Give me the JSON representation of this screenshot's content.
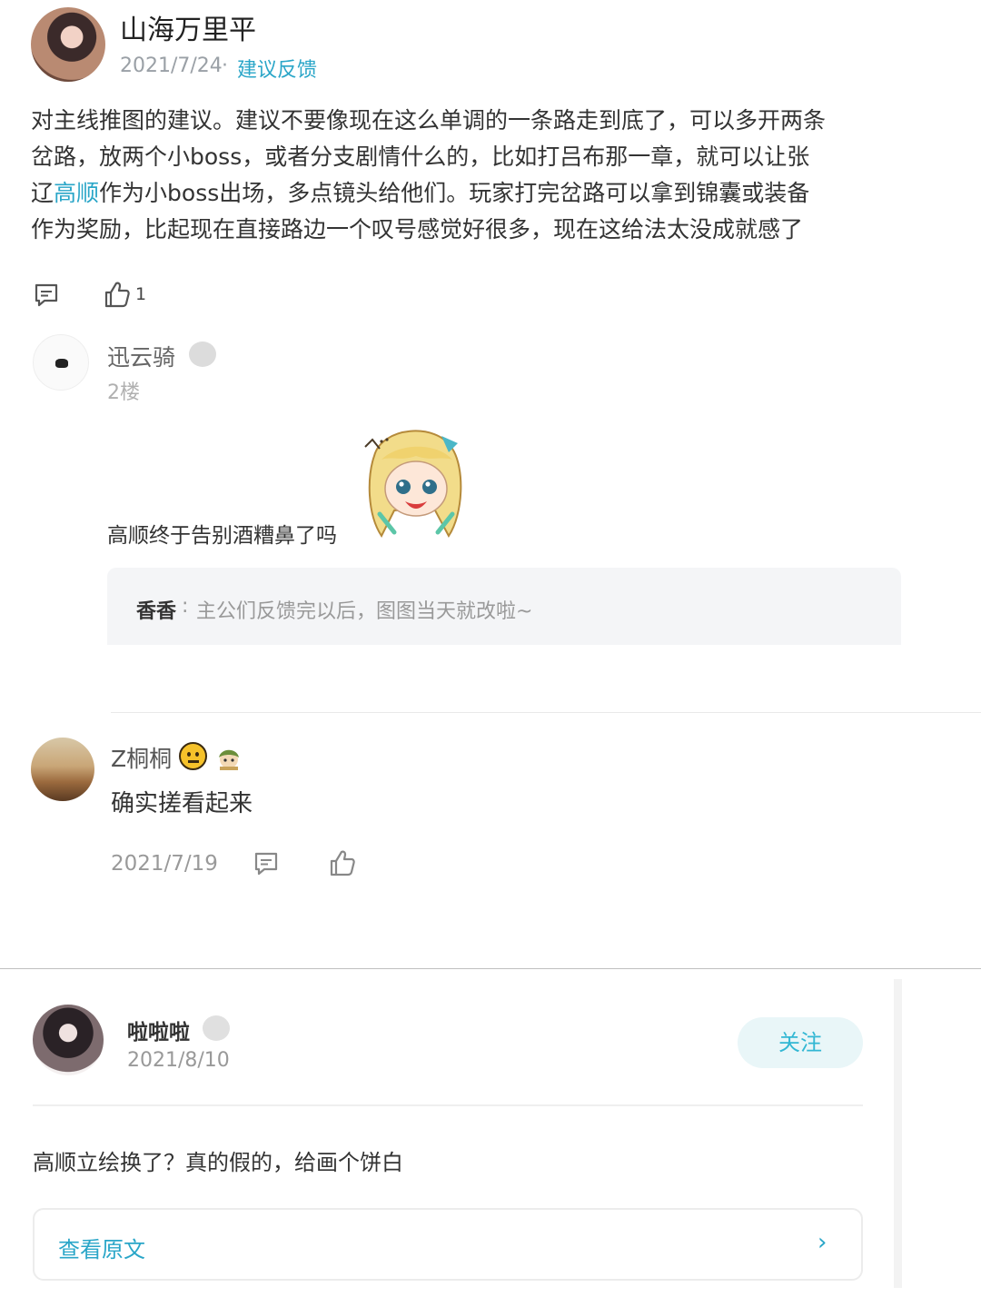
{
  "post": {
    "author": "山海万里平",
    "date": "2021/7/24",
    "separator": "·",
    "tag": "建议反馈",
    "body_lines": [
      "对主线推图的建议。建议不要像现在这么单调的一条路走到底了，可以多开两条",
      "岔路，放两个小boss，或者分支剧情什么的，比如打吕布那一章，就可以让张",
      "作为小boss出场，多点镜头给他们。玩家打完岔路可以拿到锦囊或装备",
      "作为奖励，比起现在直接路边一个叹号感觉好很多，现在这给法太没成就感了"
    ],
    "line3_prefix": "辽",
    "line3_highlight": "高顺",
    "like_count": "1"
  },
  "comment1": {
    "author": "迅云骑",
    "floor": "2楼",
    "text": "高顺终于告别酒糟鼻了吗",
    "reply": {
      "author": "香香",
      "separator": ":",
      "text": "主公们反馈完以后，图图当天就改啦~"
    }
  },
  "comment2": {
    "author": "Z桐桐",
    "text": "确实搓看起来",
    "date": "2021/7/19"
  },
  "comment3": {
    "author": "啦啦啦",
    "date": "2021/8/10",
    "follow_label": "关注",
    "text": "高顺立绘换了？真的假的，给画个饼白",
    "view_original_label": "查看原文",
    "view_original_chevron": "›"
  },
  "colors": {
    "accent": "#2aa6c8",
    "follow_bg": "#e9f6f8",
    "reply_bg": "#f4f5f7"
  }
}
